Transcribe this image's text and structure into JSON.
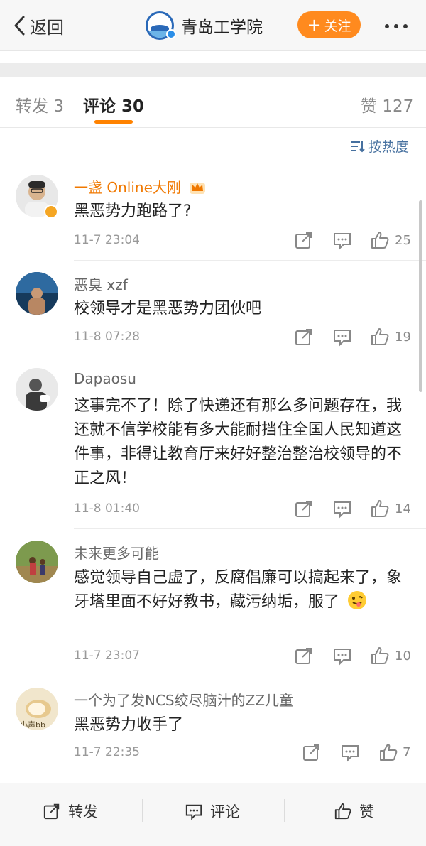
{
  "header": {
    "back_label": "返回",
    "account_name": "青岛工学院",
    "follow_label": "关注",
    "follow_plus": "+"
  },
  "tabs": [
    {
      "label": "转发",
      "count": "3"
    },
    {
      "label": "评论",
      "count": "30"
    },
    {
      "label": "赞",
      "count": "127"
    }
  ],
  "sort_label": "按热度",
  "comments": [
    {
      "name": "一盏 Online大刚",
      "text": "黑恶势力跑路了?",
      "time": "11-7 23:04",
      "likes": "25"
    },
    {
      "name": "恶臭 xzf",
      "text": "校领导才是黑恶势力团伙吧",
      "time": "11-8 07:28",
      "likes": "19"
    },
    {
      "name": "Dapaosu",
      "text": "这事完不了！除了快递还有那么多问题存在，我还就不信学校能有多大能耐挡住全国人民知道这件事，非得让教育厅来好好整治整治校领导的不正之风！",
      "time": "11-8 01:40",
      "likes": "14"
    },
    {
      "name": "未来更多可能",
      "text": "感觉领导自己虚了，反腐倡廉可以搞起来了，象牙塔里面不好好教书，藏污纳垢，服了",
      "time": "11-7 23:07",
      "likes": "10"
    },
    {
      "name": "一个为了发NCS绞尽脑汁的ZZ儿童",
      "text": "黑恶势力收手了",
      "time": "11-7 22:35",
      "likes": "7",
      "avatar_text": "小声bb"
    }
  ],
  "bottom_bar": {
    "repost_label": "转发",
    "comment_label": "评论",
    "like_label": "赞"
  },
  "colors": {
    "accent": "#ff8200",
    "follow_button": "#ff8a1e",
    "vip_name": "#f07800",
    "link_blue": "#46709f"
  },
  "icons": [
    "chevron-left-icon",
    "verified-badge-icon",
    "more-dots-icon",
    "sort-icon",
    "crown-icon",
    "repost-icon",
    "comment-icon",
    "like-icon",
    "emoji-tongue-icon"
  ]
}
